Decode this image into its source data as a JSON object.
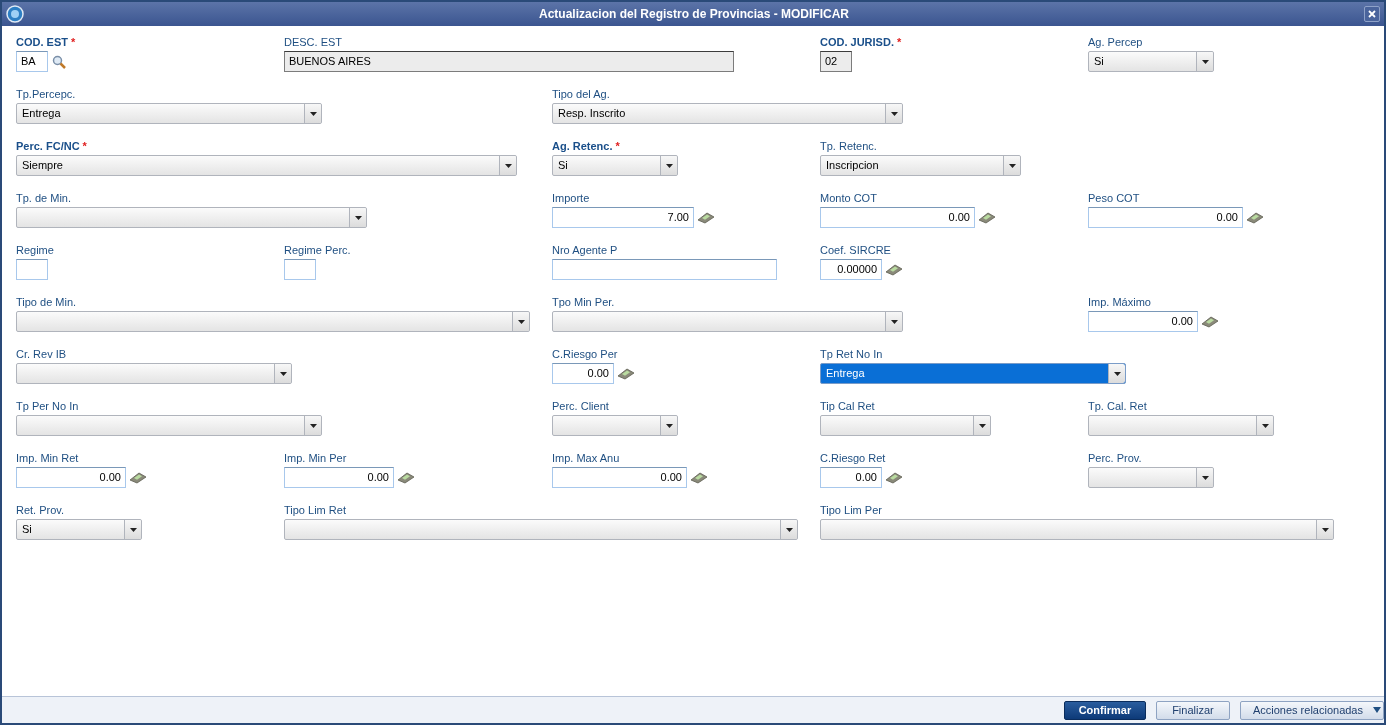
{
  "window": {
    "title": "Actualizacion del Registro de Provincias - MODIFICAR"
  },
  "rows": [
    [
      {
        "label": "COD. EST",
        "required_mark": "*",
        "kind": "text",
        "value": "BA",
        "lookup": true
      },
      {
        "label": "DESC. EST",
        "kind": "readonly",
        "value": "BUENOS AIRES"
      },
      {
        "label": "COD. JURISD.",
        "required_mark": "*",
        "kind": "readonly",
        "value": "02"
      },
      {
        "label": "Ag. Percep",
        "kind": "select",
        "value": "Si"
      }
    ],
    [
      {
        "label": "Tp.Percepc.",
        "kind": "select",
        "value": "Entrega"
      },
      {
        "label": "Tipo del Ag.",
        "kind": "select",
        "value": "Resp. Inscrito"
      }
    ],
    [
      {
        "label": "Perc. FC/NC",
        "required_mark": "*",
        "kind": "select",
        "value": "Siempre"
      },
      {
        "label": "Ag. Retenc.",
        "required_mark": "*",
        "kind": "select",
        "value": "Si"
      },
      {
        "label": "Tp. Retenc.",
        "kind": "select",
        "value": "Inscripcion"
      }
    ],
    [
      {
        "label": "Tp. de Min.",
        "kind": "select"
      },
      {
        "label": "Importe",
        "kind": "amount",
        "value": "7.00"
      },
      {
        "label": "Monto COT",
        "kind": "amount",
        "value": "0.00"
      },
      {
        "label": "Peso COT",
        "kind": "amount",
        "value": "0.00"
      }
    ],
    [
      {
        "label": "Regime",
        "kind": "text"
      },
      {
        "label": "Regime Perc.",
        "kind": "text"
      },
      {
        "label": "Nro Agente P",
        "kind": "text"
      },
      {
        "label": "Coef. SIRCRE",
        "kind": "amount",
        "value": "0.00000"
      }
    ],
    [
      {
        "label": "Tipo de Min.",
        "kind": "select"
      },
      {
        "label": "Tpo Min Per.",
        "kind": "select"
      },
      {
        "label": "Imp. Máximo",
        "kind": "amount",
        "value": "0.00"
      }
    ],
    [
      {
        "label": "Cr. Rev IB",
        "kind": "select"
      },
      {
        "label": "C.Riesgo Per",
        "kind": "amount",
        "value": "0.00"
      },
      {
        "label": "Tp Ret No In",
        "kind": "select",
        "value": "Entrega",
        "focused": true
      }
    ],
    [
      {
        "label": "Tp Per No In",
        "kind": "select"
      },
      {
        "label": "Perc. Client",
        "kind": "select"
      },
      {
        "label": "Tip Cal Ret",
        "kind": "select"
      },
      {
        "label": "Tp. Cal. Ret",
        "kind": "select"
      }
    ],
    [
      {
        "label": "Imp. Min Ret",
        "kind": "amount",
        "value": "0.00"
      },
      {
        "label": "Imp. Min Per",
        "kind": "amount",
        "value": "0.00"
      },
      {
        "label": "Imp. Max Anu",
        "kind": "amount",
        "value": "0.00"
      },
      {
        "label": "C.Riesgo Ret",
        "kind": "amount",
        "value": "0.00"
      },
      {
        "label": "Perc. Prov.",
        "kind": "select"
      }
    ],
    [
      {
        "label": "Ret. Prov.",
        "kind": "select",
        "value": "Si"
      },
      {
        "label": "Tipo Lim Ret",
        "kind": "select"
      },
      {
        "label": "Tipo Lim Per",
        "kind": "select"
      }
    ]
  ],
  "buttons": [
    {
      "label": "Confirmar",
      "primary": true,
      "menu": false
    },
    {
      "label": "Finalizar",
      "primary": false,
      "menu": false
    },
    {
      "label": "Acciones relacionadas",
      "primary": false,
      "menu": true
    }
  ]
}
